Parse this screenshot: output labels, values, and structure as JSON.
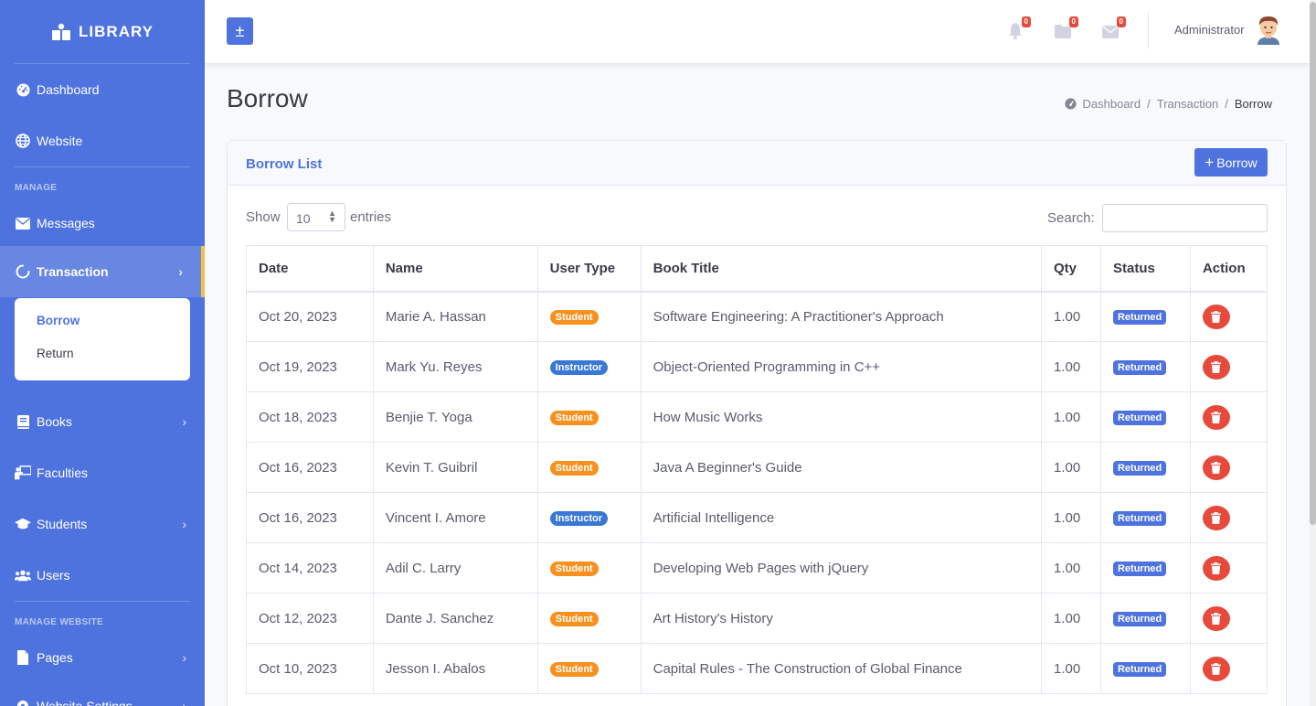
{
  "brand": {
    "name": "LIBRARY",
    "icon": "book-stack-icon"
  },
  "sidebar": {
    "items_top": [
      {
        "label": "Dashboard",
        "icon": "dashboard-gauge-icon"
      },
      {
        "label": "Website",
        "icon": "globe-icon"
      }
    ],
    "heading_manage": "MANAGE",
    "messages": {
      "label": "Messages",
      "icon": "envelope-icon"
    },
    "transaction": {
      "label": "Transaction",
      "icon": "circle-notch-icon",
      "sub": {
        "borrow": "Borrow",
        "return": "Return"
      }
    },
    "items_manage": [
      {
        "label": "Books",
        "icon": "book-icon"
      },
      {
        "label": "Faculties",
        "icon": "chalkboard-teacher-icon"
      },
      {
        "label": "Students",
        "icon": "graduation-cap-icon"
      },
      {
        "label": "Users",
        "icon": "users-icon"
      }
    ],
    "heading_website": "MANAGE WEBSITE",
    "items_website": [
      {
        "label": "Pages",
        "icon": "file-icon"
      },
      {
        "label": "Website Settings",
        "icon": "settings-icon"
      }
    ]
  },
  "topbar": {
    "toggle_glyph": "±",
    "notifications": {
      "count": "0",
      "icon": "bell-icon"
    },
    "folder": {
      "count": "0",
      "icon": "folder-icon"
    },
    "messages": {
      "count": "0",
      "icon": "envelope-icon"
    },
    "user_name": "Administrator"
  },
  "page": {
    "title": "Borrow",
    "breadcrumb": {
      "home": "Dashboard",
      "section": "Transaction",
      "current": "Borrow"
    }
  },
  "card": {
    "title": "Borrow List",
    "add_button": "Borrow",
    "show_label": "Show",
    "entries_value": "10",
    "entries_label": "entries",
    "search_label": "Search:",
    "search_value": ""
  },
  "table": {
    "headers": {
      "date": "Date",
      "name": "Name",
      "user_type": "User Type",
      "book_title": "Book Title",
      "qty": "Qty",
      "status": "Status",
      "action": "Action"
    },
    "rows": [
      {
        "date": "Oct 20, 2023",
        "name": "Marie A. Hassan",
        "user_type": "Student",
        "book_title": "Software Engineering: A Practitioner's Approach",
        "qty": "1.00",
        "status": "Returned"
      },
      {
        "date": "Oct 19, 2023",
        "name": "Mark Yu. Reyes",
        "user_type": "Instructor",
        "book_title": "Object-Oriented Programming in C++",
        "qty": "1.00",
        "status": "Returned"
      },
      {
        "date": "Oct 18, 2023",
        "name": "Benjie T. Yoga",
        "user_type": "Student",
        "book_title": "How Music Works",
        "qty": "1.00",
        "status": "Returned"
      },
      {
        "date": "Oct 16, 2023",
        "name": "Kevin T. Guibril",
        "user_type": "Student",
        "book_title": "Java A Beginner's Guide",
        "qty": "1.00",
        "status": "Returned"
      },
      {
        "date": "Oct 16, 2023",
        "name": "Vincent I. Amore",
        "user_type": "Instructor",
        "book_title": "Artificial Intelligence",
        "qty": "1.00",
        "status": "Returned"
      },
      {
        "date": "Oct 14, 2023",
        "name": "Adil C. Larry",
        "user_type": "Student",
        "book_title": "Developing Web Pages with jQuery",
        "qty": "1.00",
        "status": "Returned"
      },
      {
        "date": "Oct 12, 2023",
        "name": "Dante J. Sanchez",
        "user_type": "Student",
        "book_title": "Art History's History",
        "qty": "1.00",
        "status": "Returned"
      },
      {
        "date": "Oct 10, 2023",
        "name": "Jesson I. Abalos",
        "user_type": "Student",
        "book_title": "Capital Rules - The Construction of Global Finance",
        "qty": "1.00",
        "status": "Returned"
      }
    ]
  },
  "colors": {
    "primary": "#4e73df",
    "student": "#f6911f",
    "instructor": "#3a78d6",
    "danger": "#e74a3b",
    "active_marker": "#f6c23e"
  }
}
